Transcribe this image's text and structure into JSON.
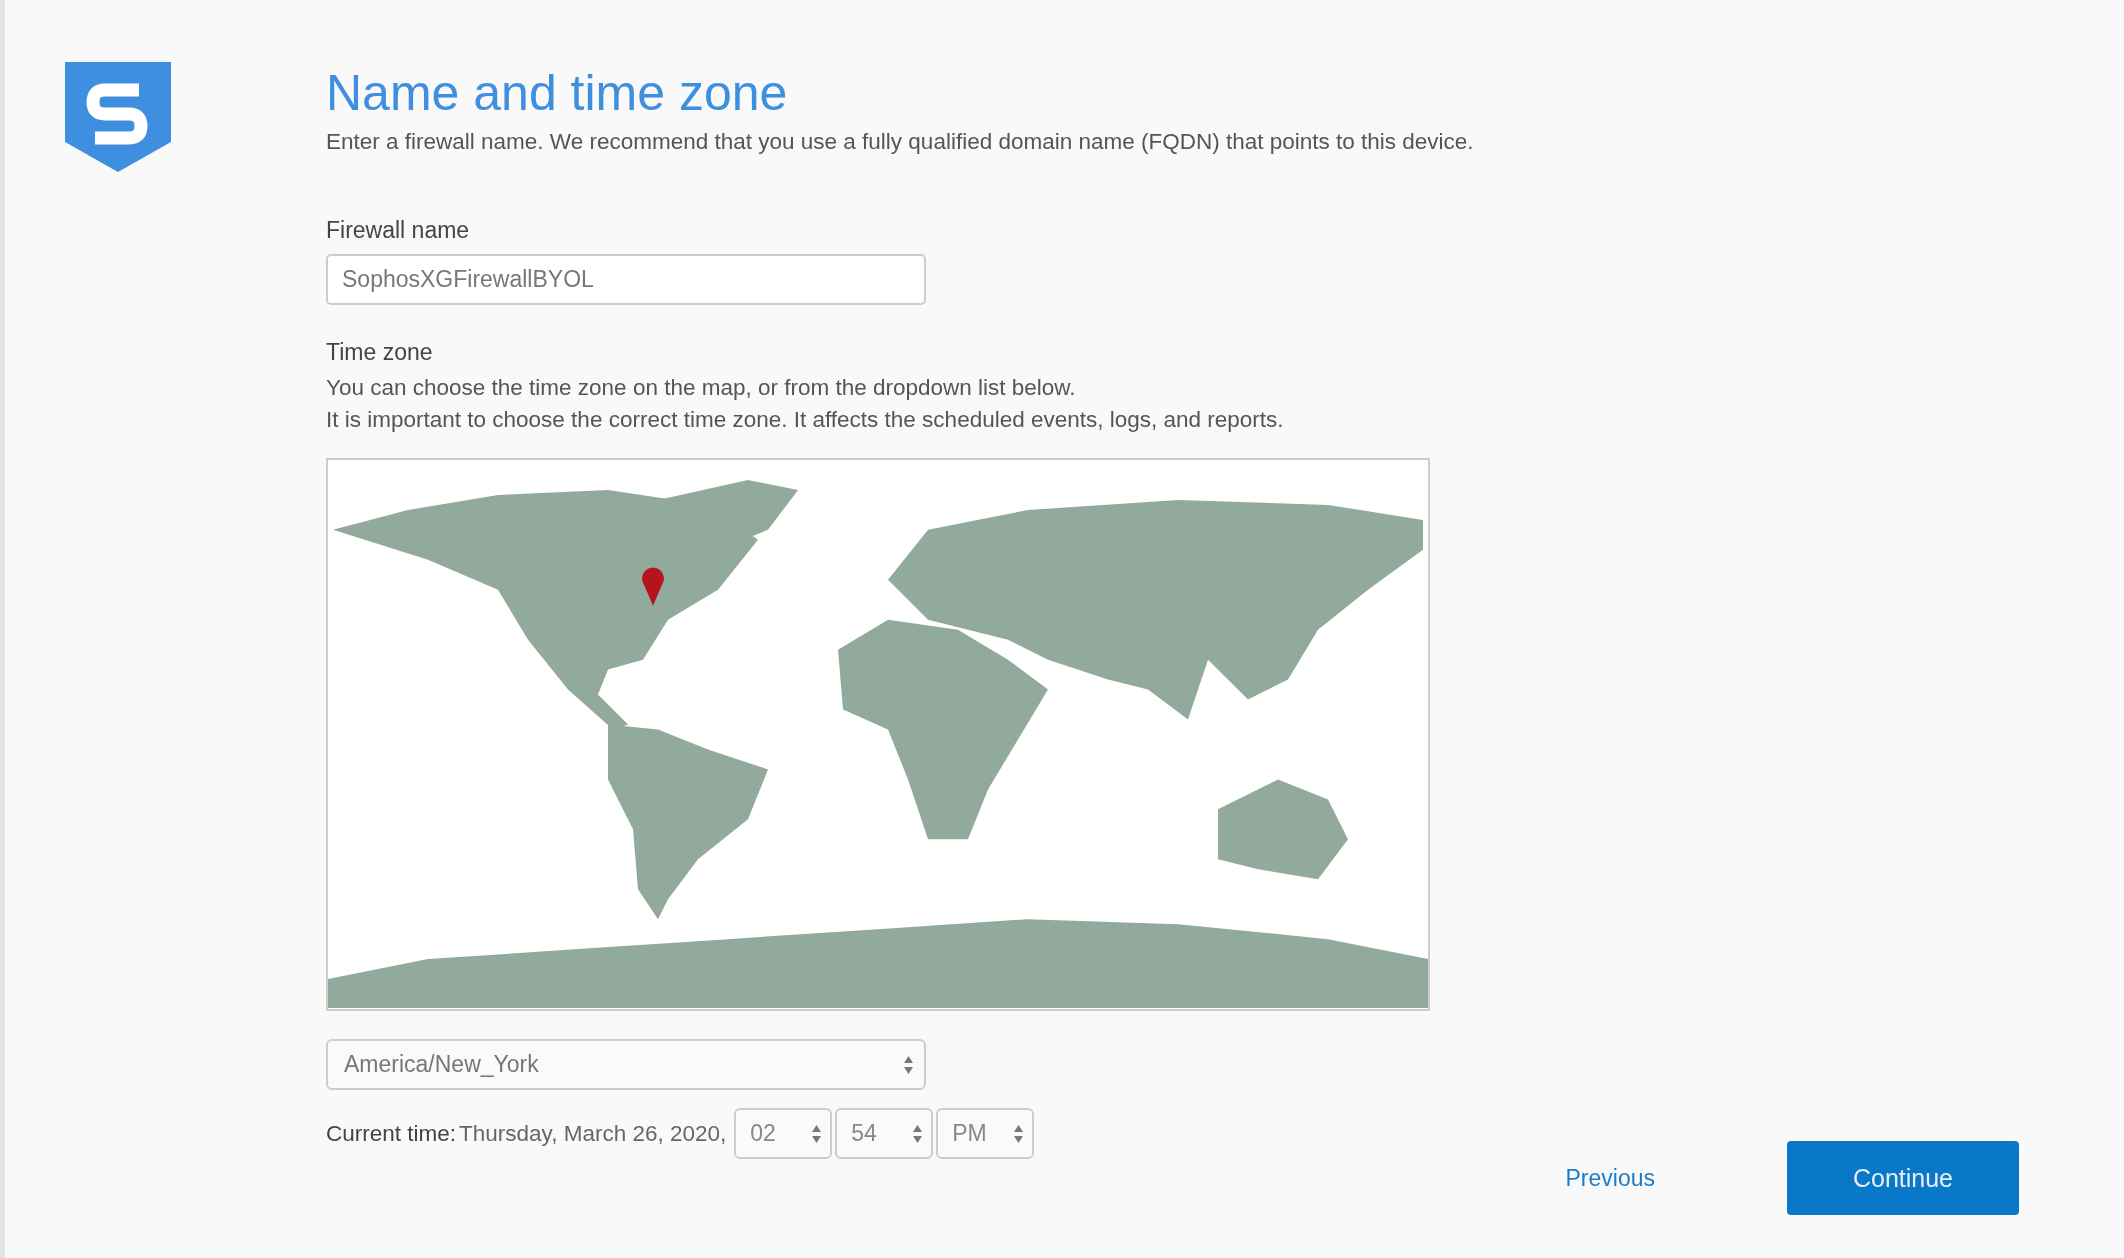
{
  "title": "Name and time zone",
  "subtitle": "Enter a firewall name. We recommend that you use a fully qualified domain name (FQDN) that points to this device.",
  "firewall_name": {
    "label": "Firewall name",
    "value": "SophosXGFirewallBYOL"
  },
  "time_zone": {
    "label": "Time zone",
    "help": [
      "You can choose the time zone on the map, or from the dropdown list below.",
      "It is important to choose the correct time zone. It affects the scheduled events, logs, and reports."
    ],
    "selected": "America/New_York"
  },
  "current_time": {
    "label": "Current time:",
    "date": "Thursday, March 26, 2020,",
    "hour": "02",
    "minute": "54",
    "meridiem": "PM"
  },
  "actions": {
    "previous": "Previous",
    "continue": "Continue"
  }
}
